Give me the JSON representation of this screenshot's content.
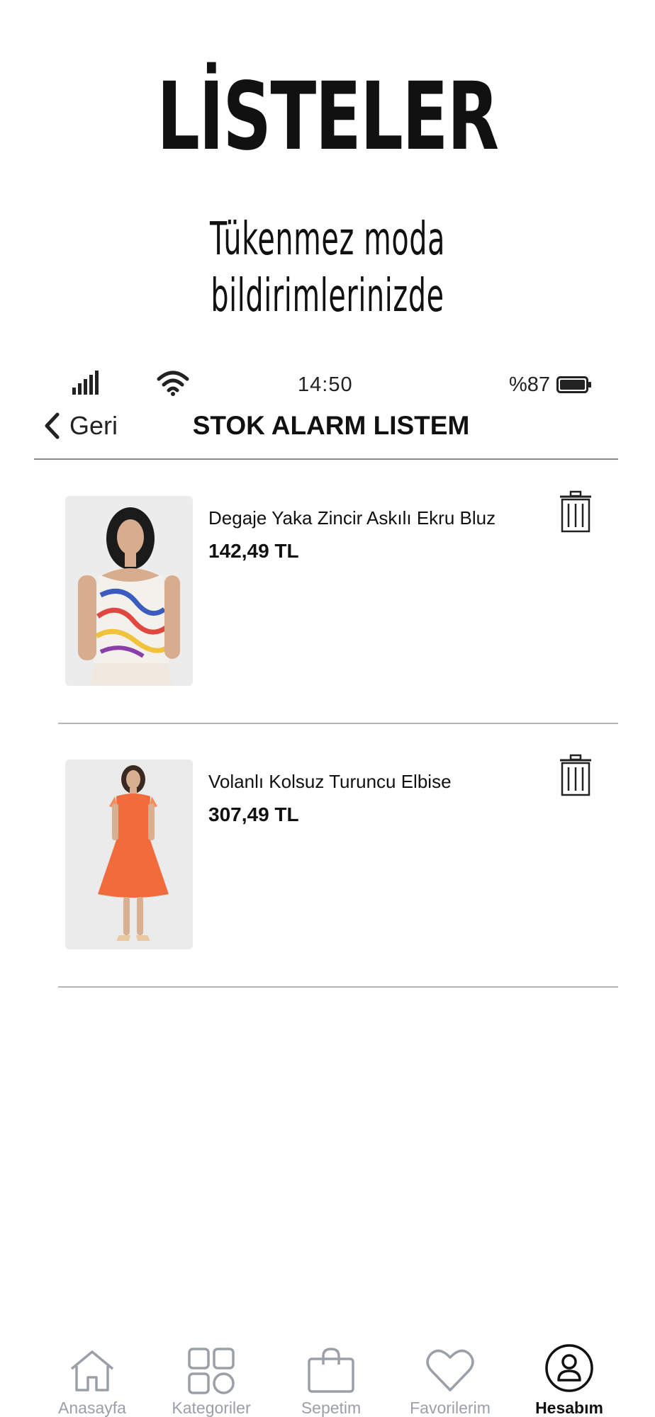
{
  "promo": {
    "title": "LİSTELER",
    "subtitle": "Tükenmez moda bildirimlerinizde"
  },
  "status_bar": {
    "time": "14:50",
    "battery": "%87",
    "icons": [
      "signal-icon",
      "wifi-icon",
      "battery-icon"
    ]
  },
  "header": {
    "back_label": "Geri",
    "title": "STOK ALARM LISTEM"
  },
  "items": [
    {
      "name": "Degaje Yaka Zincir Askılı Ekru Bluz",
      "price": "142,49 TL",
      "icon": "trash-icon"
    },
    {
      "name": "Volanlı Kolsuz Turuncu Elbise",
      "price": "307,49 TL",
      "icon": "trash-icon"
    }
  ],
  "tabs": [
    {
      "label": "Anasayfa",
      "icon": "home-icon",
      "active": false
    },
    {
      "label": "Kategoriler",
      "icon": "grid-icon",
      "active": false
    },
    {
      "label": "Sepetim",
      "icon": "shopping-bag-icon",
      "active": false
    },
    {
      "label": "Favorilerim",
      "icon": "heart-icon",
      "active": false
    },
    {
      "label": "Hesabım",
      "icon": "user-icon",
      "active": true
    }
  ],
  "colors": {
    "text": "#111111",
    "inactive_tab": "#9a9fa8",
    "divider": "#b5b5b5",
    "dress_orange": "#f26b3a"
  }
}
